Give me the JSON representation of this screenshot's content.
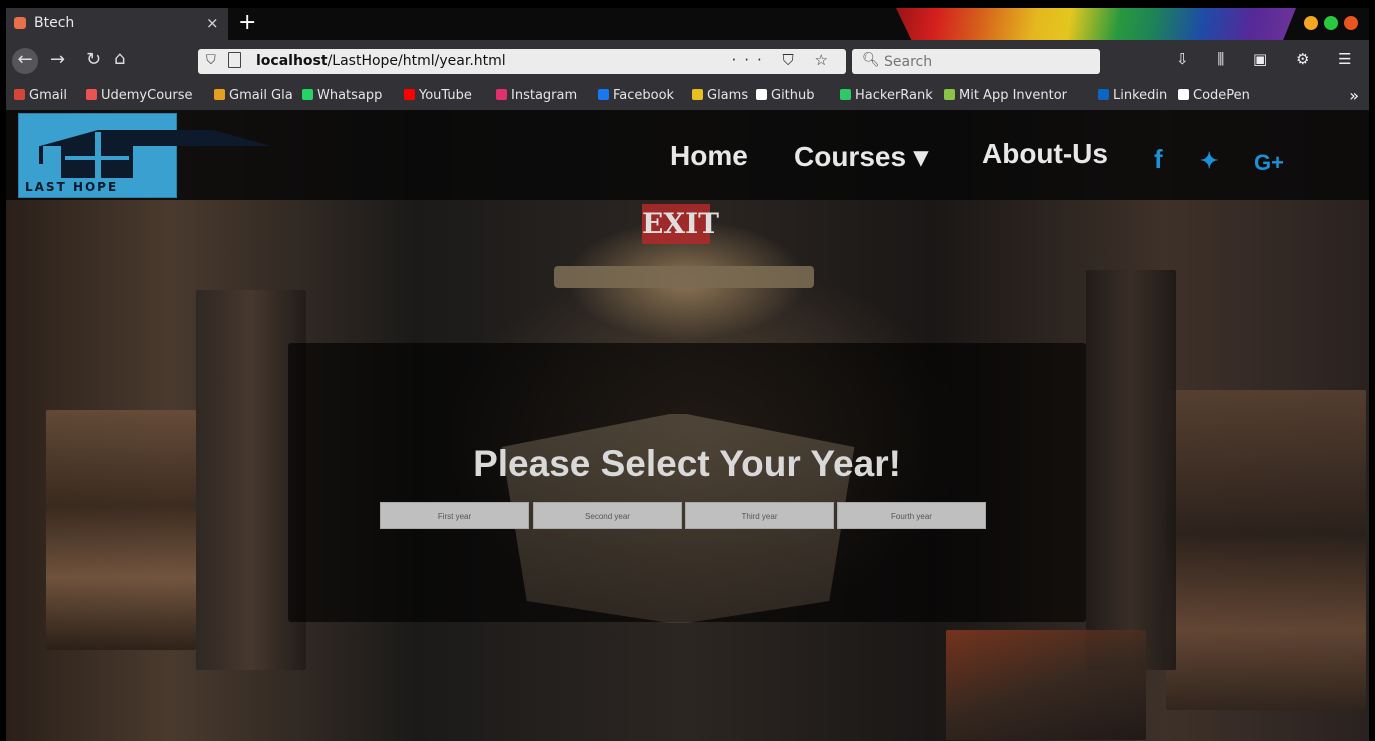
{
  "browser": {
    "tab_title": "Btech",
    "tab_close": "×",
    "new_tab": "+",
    "url_host": "localhost",
    "url_path": "/LastHope/html/year.html",
    "url_tools": "··· ⛉ ☆",
    "search_placeholder": "Search",
    "colors": {
      "close_dot": "#e95420",
      "min_dot": "#f5a623",
      "max_dot": "#28c840"
    }
  },
  "bookmarks": [
    {
      "label": "Gmail",
      "color": "#d44638"
    },
    {
      "label": "UdemyCourse",
      "color": "#ec5252"
    },
    {
      "label": "Gmail Gla",
      "color": "#e6a020"
    },
    {
      "label": "Whatsapp",
      "color": "#25d366"
    },
    {
      "label": "YouTube",
      "color": "#ff0000"
    },
    {
      "label": "Instagram",
      "color": "#e1306c"
    },
    {
      "label": "Facebook",
      "color": "#1877f2"
    },
    {
      "label": "Glams",
      "color": "#e6c020"
    },
    {
      "label": "Github",
      "color": "#ffffff"
    },
    {
      "label": "HackerRank",
      "color": "#2ec866"
    },
    {
      "label": "Mit App Inventor",
      "color": "#8bc34a"
    },
    {
      "label": "Linkedin",
      "color": "#0a66c2"
    },
    {
      "label": "CodePen",
      "color": "#ffffff"
    }
  ],
  "site": {
    "logo_text": "LAST HOPE",
    "nav": {
      "home": "Home",
      "courses": "Courses ▾",
      "about": "About-Us"
    },
    "social": {
      "facebook": "f",
      "twitter": "🐦",
      "google": "G+"
    },
    "colors": {
      "nav_text": "#e8e8e8",
      "social": "#1e90d6",
      "logo_bg": "#3aa0cf"
    }
  },
  "year_panel": {
    "heading": "Please Select Your Year!",
    "buttons": [
      "First year",
      "Second year",
      "Third year",
      "Fourth year"
    ]
  },
  "background": {
    "sign": "EXIT"
  }
}
